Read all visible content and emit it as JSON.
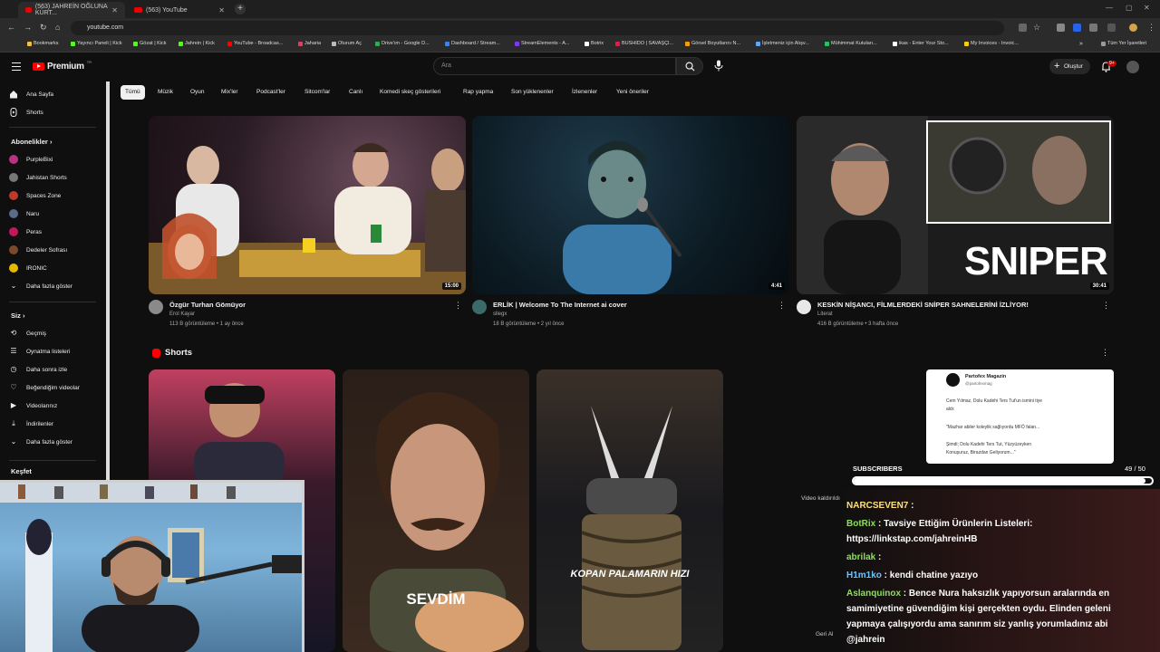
{
  "browser": {
    "tabs": [
      {
        "title": "(563) JAHREİN OĞLUNA KÜRT..."
      },
      {
        "title": "(563) YouTube"
      }
    ],
    "url": "youtube.com",
    "bookmarks": [
      {
        "label": "Bookmarks",
        "color": "#f0c040"
      },
      {
        "label": "Yayıncı Paneli | Kick",
        "color": "#53fc18"
      },
      {
        "label": "Gözat | Kick",
        "color": "#53fc18"
      },
      {
        "label": "Jahrein | Kick",
        "color": "#53fc18"
      },
      {
        "label": "YouTube - Broadcas...",
        "color": "#ff0000"
      },
      {
        "label": "Jaharia",
        "color": "#e04060"
      },
      {
        "label": "Oturum Aç",
        "color": "#bbbbbb"
      },
      {
        "label": "Drive'ım - Google D...",
        "color": "#34a853"
      },
      {
        "label": "Dashboard / Stream...",
        "color": "#3b82f6"
      },
      {
        "label": "StreamElements - A...",
        "color": "#7c3aed"
      },
      {
        "label": "Botrix",
        "color": "#ffffff"
      },
      {
        "label": "BUSHIDO | SAVAŞÇI...",
        "color": "#e11d48"
      },
      {
        "label": "Görsel Boyutlarını N...",
        "color": "#f59e0b"
      },
      {
        "label": "İşletmeniz için Alışv...",
        "color": "#60a5fa"
      },
      {
        "label": "Mühimmat Kutuları...",
        "color": "#22c55e"
      },
      {
        "label": "ikas - Enter Your Sto...",
        "color": "#ffffff"
      },
      {
        "label": "My Invoices - Invoic...",
        "color": "#facc15"
      }
    ],
    "bookmarks_more": "»",
    "other_bookmarks": "Tüm Yer İşaretleri"
  },
  "youtube": {
    "logo": "Premium",
    "logo_region": "TR",
    "search_placeholder": "Ara",
    "create_label": "Oluştur",
    "notif_badge": "9+"
  },
  "sidebar": {
    "home": "Ana Sayfa",
    "shorts": "Shorts",
    "subscriptions_header": "Abonelikler",
    "subscriptions": [
      {
        "label": "PurpleBixi",
        "color": "#b83280"
      },
      {
        "label": "Jahistan Shorts",
        "color": "#777777"
      },
      {
        "label": "Spaces Zone",
        "color": "#c0392b"
      },
      {
        "label": "Naru",
        "color": "#5a6b8c"
      },
      {
        "label": "Peras",
        "color": "#c2185b"
      },
      {
        "label": "Dedeler Sofrası",
        "color": "#7a4a2a"
      },
      {
        "label": "IRONIC",
        "color": "#e6b800"
      }
    ],
    "show_more": "Daha fazla göster",
    "you_header": "Siz",
    "you_items": [
      {
        "label": "Geçmiş"
      },
      {
        "label": "Oynatma listeleri"
      },
      {
        "label": "Daha sonra izle"
      },
      {
        "label": "Beğendiğim videolar"
      },
      {
        "label": "Videolarınız"
      },
      {
        "label": "İndirilenler"
      },
      {
        "label": "Daha fazla göster"
      }
    ],
    "explore_header": "Keşfet"
  },
  "chips": [
    "Tümü",
    "Müzik",
    "Oyun",
    "Mix'ler",
    "Podcast'ler",
    "Sitcom'lar",
    "Canlı",
    "Komedi skeç gösterileri",
    "Rap yapma",
    "Son yüklenenler",
    "İzlenenler",
    "Yeni öneriler"
  ],
  "videos": [
    {
      "title": "Özgür Turhan Gömüyor",
      "channel": "Erol Kayar",
      "stats": "113 B görüntüleme • 1 ay önce",
      "duration": "15:00"
    },
    {
      "title": "ERLİK | Welcome To The Internet ai cover",
      "channel": "sllegx",
      "stats": "18 B görüntüleme • 2 yıl önce",
      "duration": "4:41"
    },
    {
      "title": "KESKİN NİŞANCI, FİLMLERDEKİ SNİPER SAHNELERİNİ İZLİYOR!",
      "channel": "Literat",
      "stats": "416 B görüntüleme • 3 hafta önce",
      "duration": "30:41",
      "overlay": "SNIPER"
    }
  ],
  "shorts_header": "Shorts",
  "shorts": [
    {
      "caption": ""
    },
    {
      "caption": "SEVDİM"
    },
    {
      "caption": "KOPAN PALAMARIN HIZI"
    }
  ],
  "short_removed": "Video kaldırıldı",
  "short_back": "Geri Al",
  "tweet": {
    "name": "Partofex Magazin",
    "handle": "@partofexmag",
    "lines": [
      "Cem Yılmaz, Dolu Kadehi Ters Tut'un ismini tiye",
      "aldı:",
      "\"Mazhar abiler koleylik sağlıyordu MFÖ falan...",
      "Şimdi; Dolu Kadehi Ters Tut, Yüzyüzeyken",
      "Konuşuruz, Birazdan Geliyorum...\""
    ]
  },
  "subscribers": {
    "label": "SUBSCRIBERS",
    "count": "49",
    "goal": "/ 50",
    "progress": 0.98
  },
  "chat": [
    {
      "name": "NARCSEVEN7",
      "text": " : ",
      "color": "yellow"
    },
    {
      "name": "BotRix",
      "text": " : Tavsiye Ettiğim Ürünlerin Listeleri:",
      "color": "green"
    },
    {
      "name": "",
      "text": "https://linkstap.com/jahreinHB",
      "color": "yellow"
    },
    {
      "name": "abrilak",
      "text": " : ",
      "color": "green"
    },
    {
      "name": "H1m1ko",
      "text": " : kendi chatine yazıyo",
      "color": "blue"
    },
    {
      "name": "Aslanquinox",
      "text": " : Bence Nura haksızlık yapıyorsun aralarında en",
      "color": "green"
    },
    {
      "name": "",
      "text": "samimiyetine güvendiğim kişi gerçekten oydu. Elinden geleni",
      "color": "yellow"
    },
    {
      "name": "",
      "text": "yapmaya çalışıyordu ama sanırım siz yanlış yorumladınız abi",
      "color": "yellow"
    },
    {
      "name": "",
      "text": "@jahrein",
      "color": "yellow"
    }
  ]
}
